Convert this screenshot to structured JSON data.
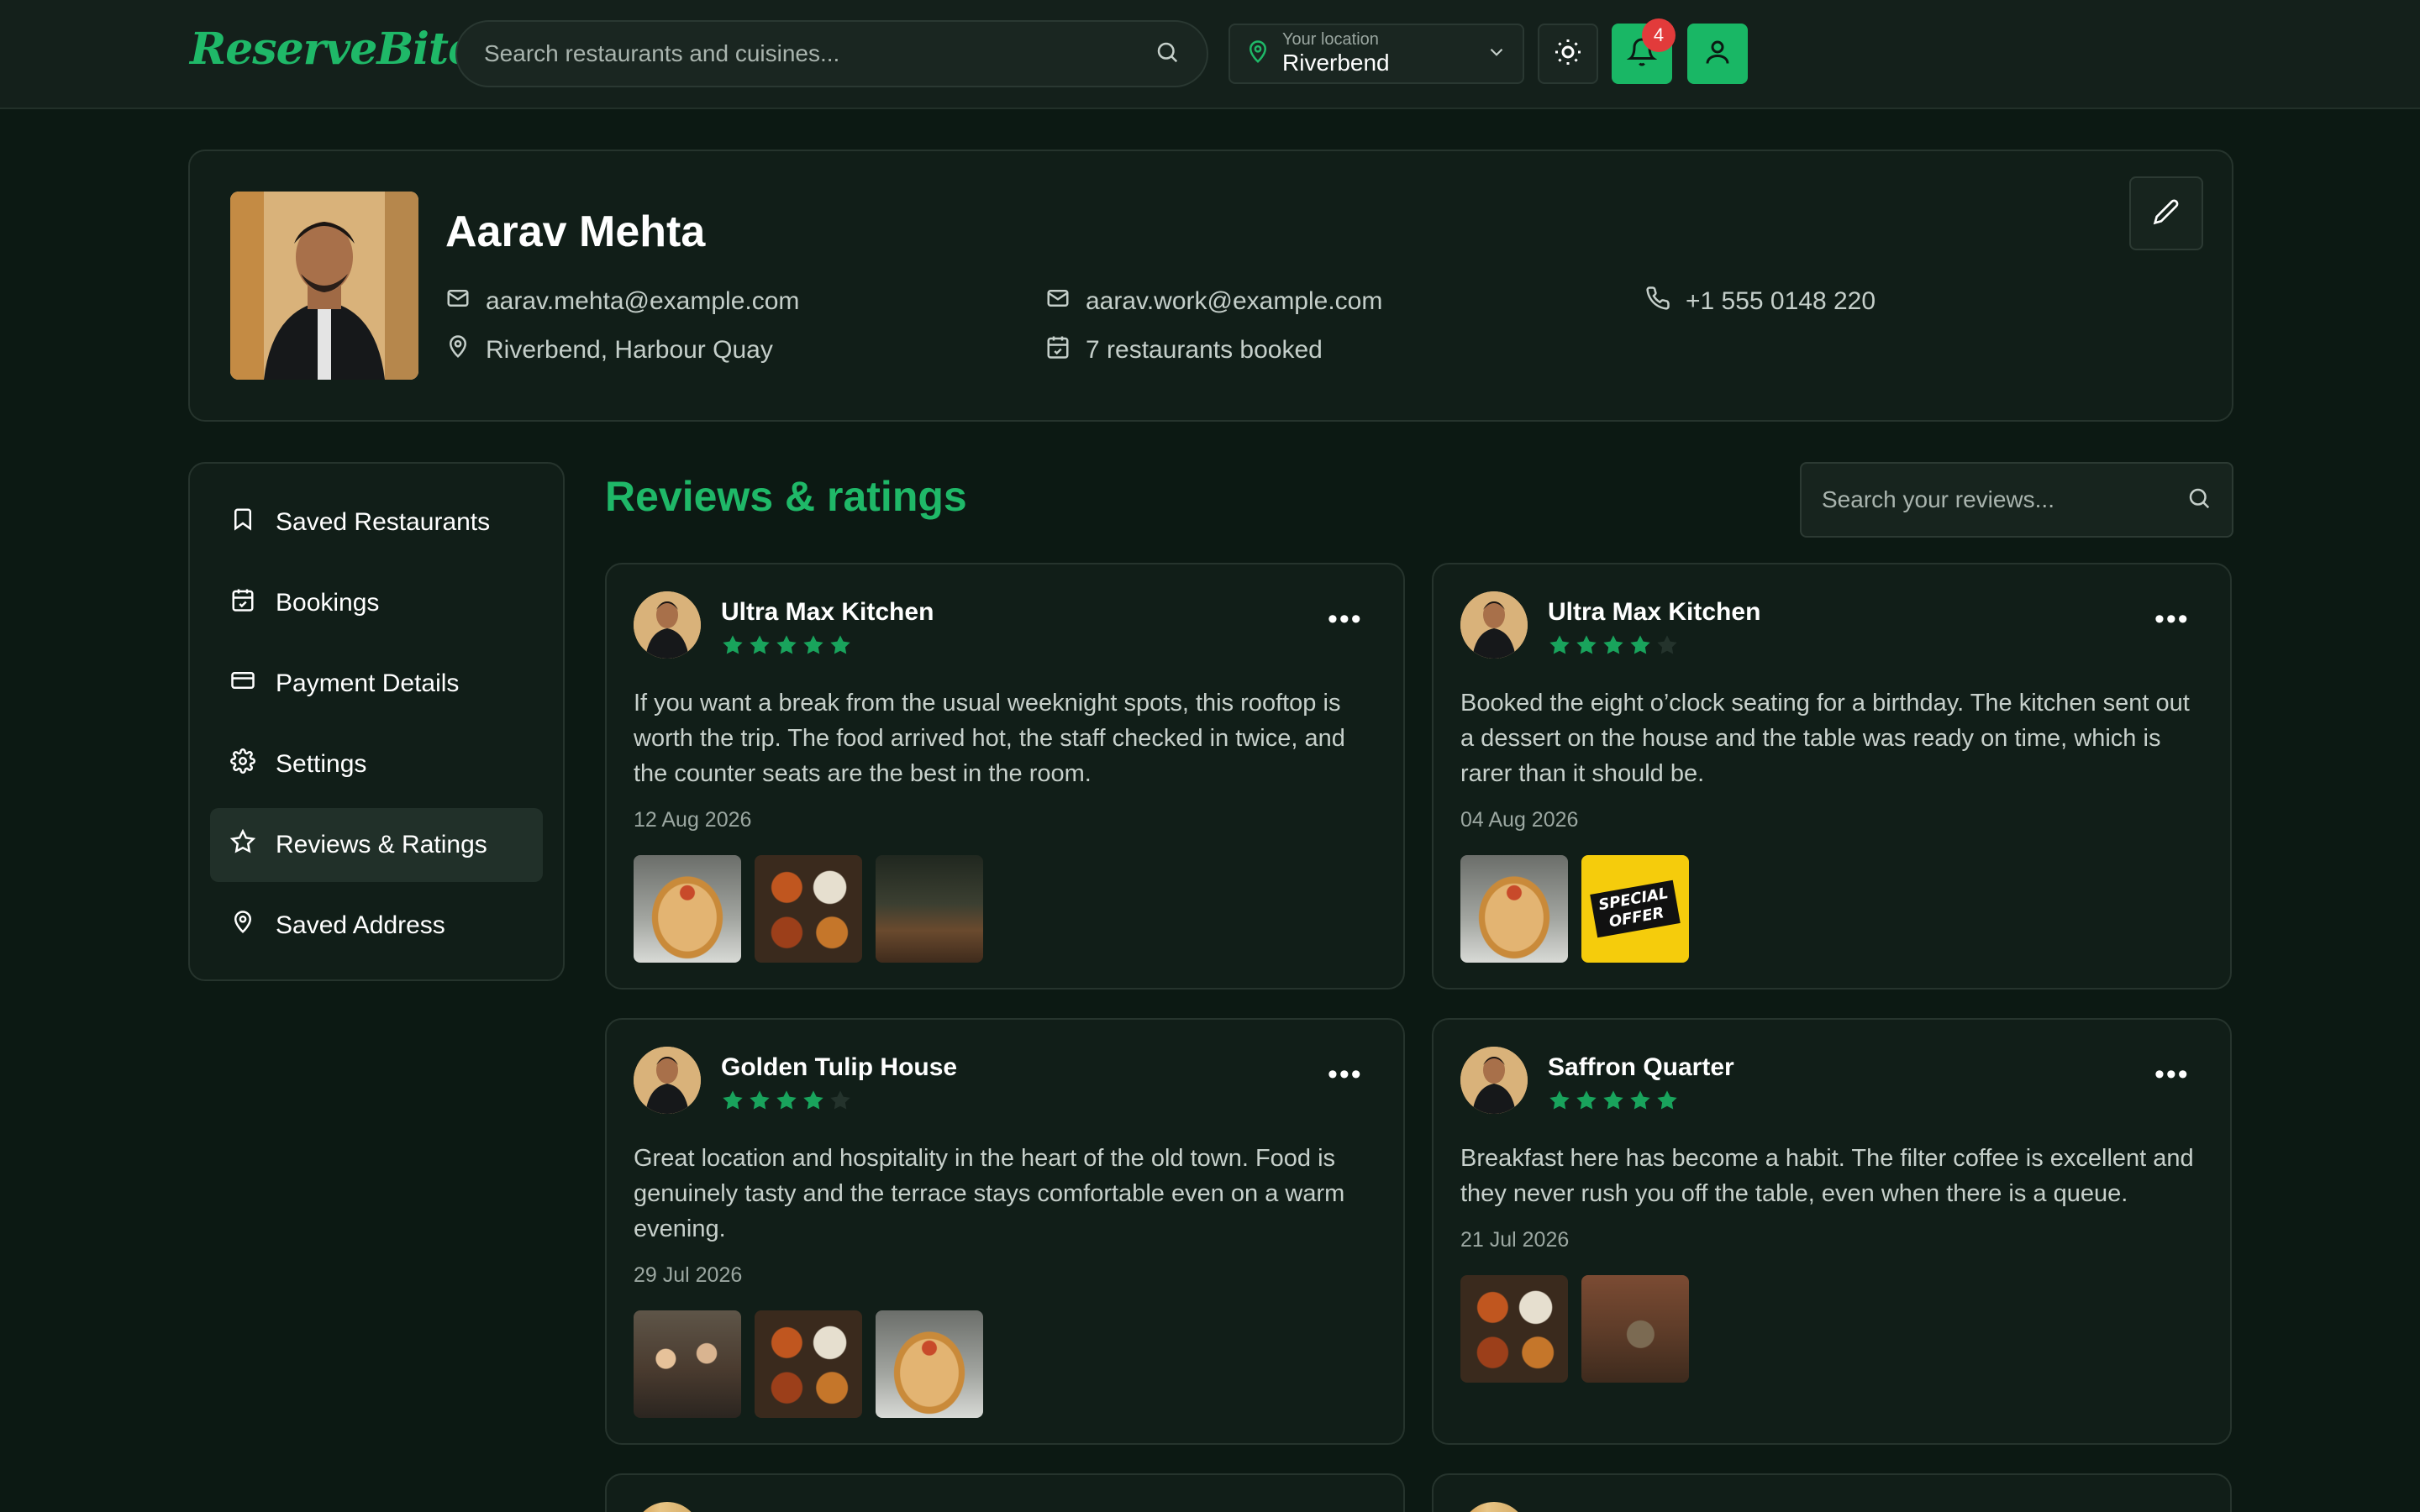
{
  "header": {
    "logo": "ReserveBite",
    "search_placeholder": "Search restaurants and cuisines...",
    "location_label": "Your location",
    "location_value": "Riverbend",
    "notification_count": "4",
    "accent_color": "#19b765"
  },
  "profile": {
    "name": "Aarav Mehta",
    "email": "aarav.mehta@example.com",
    "work_email": "aarav.work@example.com",
    "phone": "+1 555 0148 220",
    "address": "Riverbend, Harbour Quay",
    "bookings": "7 restaurants booked"
  },
  "sidebar": {
    "items": [
      {
        "label": "Saved Restaurants",
        "icon": "bookmark-icon"
      },
      {
        "label": "Bookings",
        "icon": "calendar-check-icon"
      },
      {
        "label": "Payment Details",
        "icon": "credit-card-icon"
      },
      {
        "label": "Settings",
        "icon": "gear-icon"
      },
      {
        "label": "Reviews & Ratings",
        "icon": "star-icon",
        "active": true
      },
      {
        "label": "Saved Address",
        "icon": "map-pin-icon"
      }
    ]
  },
  "main": {
    "title": "Reviews & ratings",
    "search_placeholder": "Search your reviews..."
  },
  "reviews": [
    {
      "restaurant": "Ultra Max Kitchen",
      "rating": 5,
      "text": "If you want a break from the usual weeknight spots, this rooftop is worth the trip. The food arrived hot, the staff checked in twice, and the counter seats are the best in the room.",
      "date": "12 Aug 2026",
      "photos": [
        "pancake",
        "curry",
        "bar"
      ]
    },
    {
      "restaurant": "Ultra Max Kitchen",
      "rating": 4,
      "text": "Booked the eight o’clock seating for a birthday. The kitchen sent out a dessert on the house and the table was ready on time, which is rarer than it should be.",
      "date": "04 Aug 2026",
      "photos": [
        "pancake",
        "offer"
      ]
    },
    {
      "restaurant": "Golden Tulip House",
      "rating": 4,
      "text": "Great location and hospitality in the heart of the old town. Food is genuinely tasty and the terrace stays comfortable even on a warm evening.",
      "date": "29 Jul 2026",
      "photos": [
        "people",
        "curry",
        "pancake"
      ]
    },
    {
      "restaurant": "Saffron Quarter",
      "rating": 5,
      "text": "Breakfast here has become a habit. The filter coffee is excellent and they never rush you off the table, even when there is a queue.",
      "date": "21 Jul 2026",
      "photos": [
        "curry",
        "cafe"
      ]
    }
  ],
  "offer_badge": {
    "line1": "SPECIAL",
    "line2": "OFFER"
  }
}
